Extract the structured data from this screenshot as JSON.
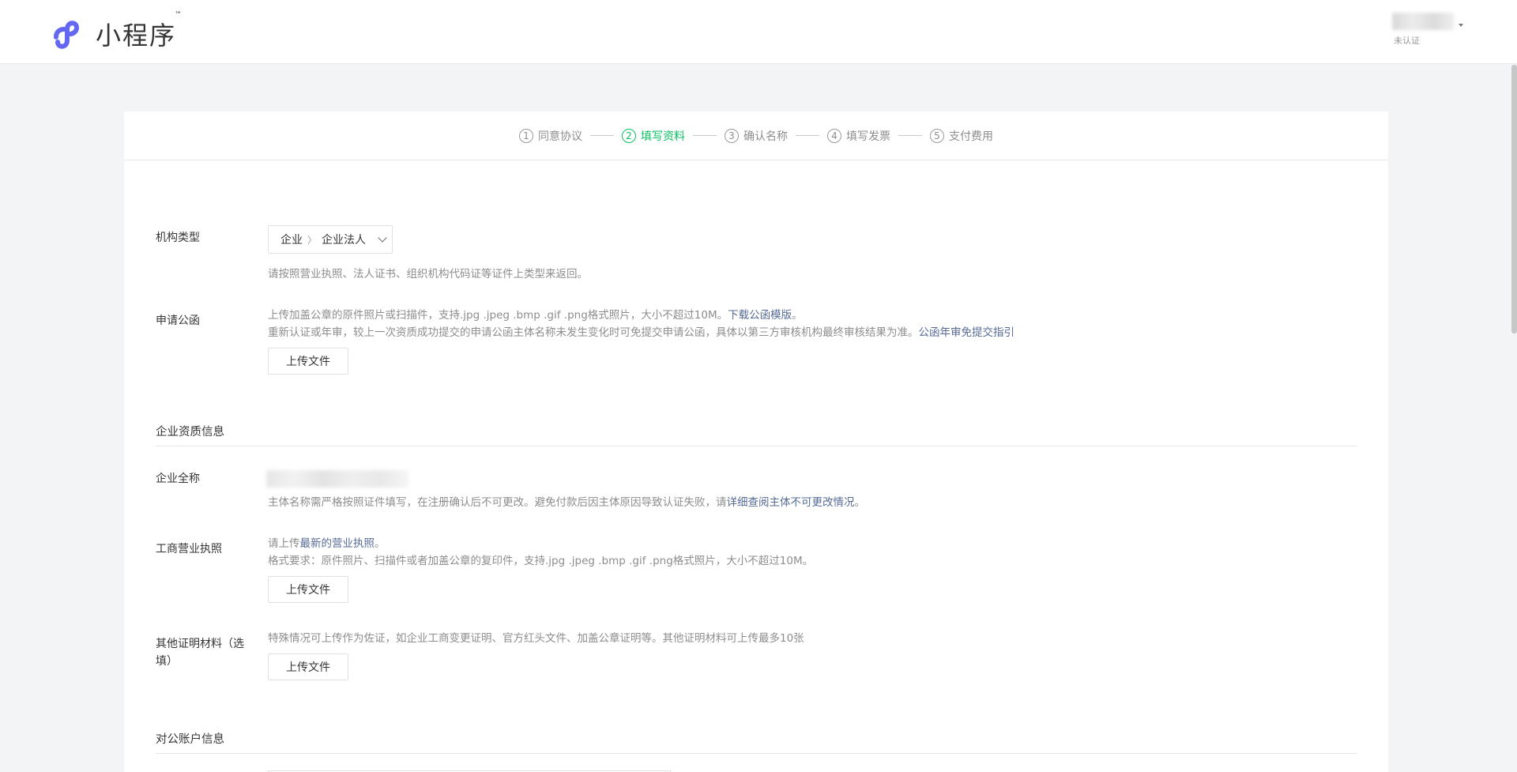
{
  "header": {
    "logo_text": "小程序",
    "logo_tm": "™",
    "account_status": "未认证"
  },
  "steps": [
    {
      "num": "1",
      "label": "同意协议",
      "active": false
    },
    {
      "num": "2",
      "label": "填写资料",
      "active": true
    },
    {
      "num": "3",
      "label": "确认名称",
      "active": false
    },
    {
      "num": "4",
      "label": "填写发票",
      "active": false
    },
    {
      "num": "5",
      "label": "支付费用",
      "active": false
    }
  ],
  "org_type": {
    "label": "机构类型",
    "value_level1": "企业",
    "value_level2": "企业法人",
    "hint": "请按照营业执照、法人证书、组织机构代码证等证件上类型来返回。"
  },
  "letter": {
    "label": "申请公函",
    "hint1_prefix": "上传加盖公章的原件照片或扫描件，支持.jpg .jpeg .bmp .gif .png格式照片，大小不超过10M。",
    "hint1_link": "下载公函模版",
    "hint1_suffix": "。",
    "hint2_prefix": "重新认证或年审，较上一次资质成功提交的申请公函主体名称未发生变化时可免提交申请公函，具体以第三方审核机构最终审核结果为准。",
    "hint2_link": "公函年审免提交指引",
    "upload_label": "上传文件"
  },
  "qualification_section": {
    "title": "企业资质信息"
  },
  "company_name": {
    "label": "企业全称",
    "hint_prefix": "主体名称需严格按照证件填写，在注册确认后不可更改。避免付款后因主体原因导致认证失败，请",
    "hint_link": "详细查阅主体不可更改情况",
    "hint_suffix": "。"
  },
  "business_license": {
    "label": "工商营业执照",
    "hint1_prefix": "请上传",
    "hint1_link": "最新的营业执照",
    "hint1_suffix": "。",
    "hint2": "格式要求：原件照片、扫描件或者加盖公章的复印件，支持.jpg .jpeg .bmp .gif .png格式照片，大小不超过10M。",
    "upload_label": "上传文件"
  },
  "other_materials": {
    "label_line1": "其他证明材料（选",
    "label_line2": "填）",
    "hint": "特殊情况可上传作为佐证，如企业工商变更证明、官方红头文件、加盖公章证明等。其他证明材料可上传最多10张",
    "upload_label": "上传文件"
  },
  "bank_section": {
    "title": "对公账户信息"
  },
  "colors": {
    "accent_green": "#07c160",
    "link_blue": "#576b95",
    "logo_purple": "#6467f0"
  }
}
